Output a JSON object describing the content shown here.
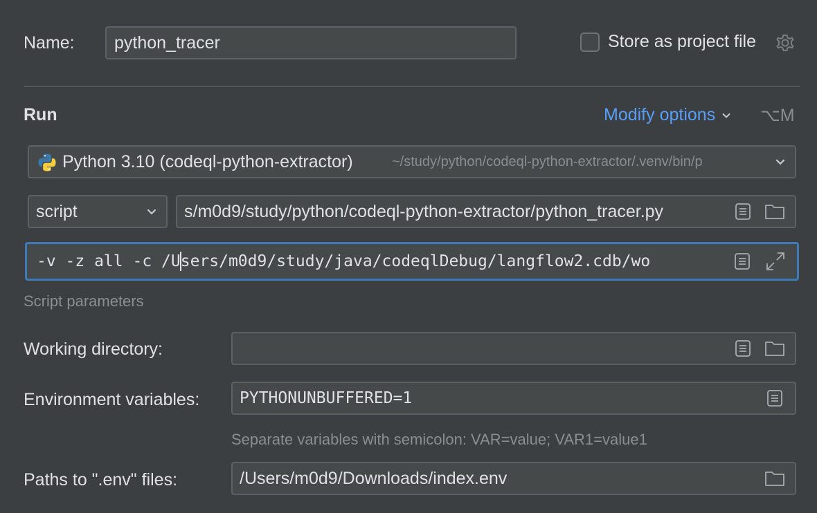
{
  "name_row": {
    "label": "Name:",
    "value": "python_tracer",
    "store_label": "Store as project file",
    "store_checked": false
  },
  "run": {
    "section_title": "Run",
    "modify_options": "Modify options",
    "shortcut": "⌥M"
  },
  "interpreter": {
    "name": "Python 3.10 (codeql-python-extractor)",
    "path": "~/study/python/codeql-python-extractor/.venv/bin/p"
  },
  "script": {
    "type": "script",
    "path": "s/m0d9/study/python/codeql-python-extractor/python_tracer.py"
  },
  "params": {
    "value_before_caret": "-v -z all -c /U",
    "value_after_caret": "sers/m0d9/study/java/codeqlDebug/langflow2.cdb/wo",
    "hint": "Script parameters"
  },
  "working_dir": {
    "label": "Working directory:",
    "value": ""
  },
  "env_vars": {
    "label": "Environment variables:",
    "value": "PYTHONUNBUFFERED=1",
    "hint": "Separate variables with semicolon: VAR=value; VAR1=value1"
  },
  "env_files": {
    "label": "Paths to \".env\" files:",
    "value": "/Users/m0d9/Downloads/index.env"
  },
  "colors": {
    "accent": "#589df6",
    "focus_border": "#3d7ab8"
  }
}
